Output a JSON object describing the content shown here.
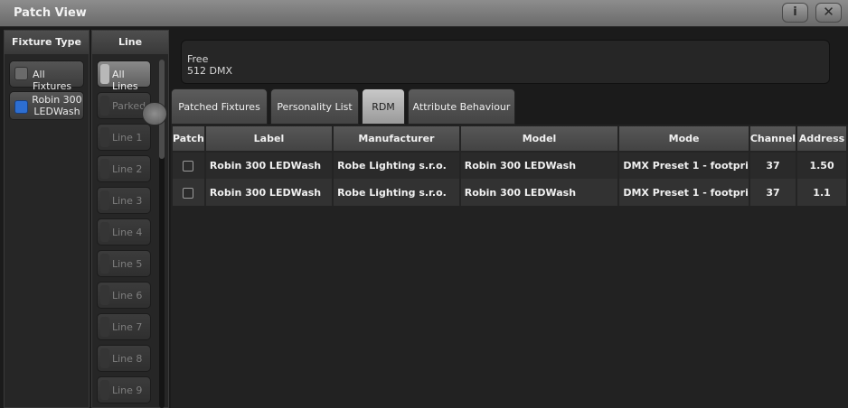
{
  "window": {
    "title": "Patch View",
    "info_icon": "i",
    "close_icon": "✕"
  },
  "fixture_type": {
    "header": "Fixture Type",
    "items": [
      {
        "label": "All Fixtures"
      },
      {
        "label": "Robin 300 LEDWash"
      }
    ]
  },
  "lines": {
    "header": "Line",
    "items": [
      {
        "label": "All Lines"
      },
      {
        "label": "Parked"
      },
      {
        "label": "Line 1"
      },
      {
        "label": "Line 2"
      },
      {
        "label": "Line 3"
      },
      {
        "label": "Line 4"
      },
      {
        "label": "Line 5"
      },
      {
        "label": "Line 6"
      },
      {
        "label": "Line 7"
      },
      {
        "label": "Line 8"
      },
      {
        "label": "Line 9"
      }
    ]
  },
  "free_box": {
    "line1": "Free",
    "line2": "512 DMX"
  },
  "tabs": [
    {
      "label": "Patched Fixtures"
    },
    {
      "label": "Personality List"
    },
    {
      "label": "RDM"
    },
    {
      "label": "Attribute Behaviour"
    }
  ],
  "table": {
    "columns": [
      "Patch",
      "Label",
      "Manufacturer",
      "Model",
      "Mode",
      "Channel",
      "Address"
    ],
    "rows": [
      {
        "label": "Robin 300 LEDWash",
        "manufacturer": "Robe Lighting s.r.o.",
        "model": "Robin 300 LEDWash",
        "mode": "DMX Preset 1 - footpri",
        "channel": "37",
        "address": "1.50"
      },
      {
        "label": "Robin 300 LEDWash",
        "manufacturer": "Robe Lighting s.r.o.",
        "model": "Robin 300 LEDWash",
        "mode": "DMX Preset 1 - footpri",
        "channel": "37",
        "address": "1.1"
      }
    ]
  }
}
